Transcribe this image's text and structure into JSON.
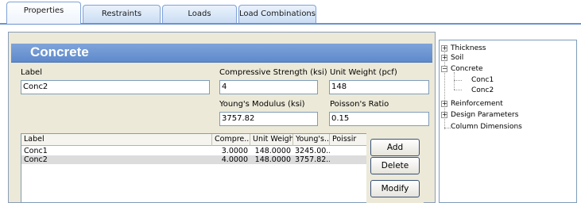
{
  "tabs": [
    {
      "label": "Properties",
      "active": true
    },
    {
      "label": "Restraints",
      "active": false
    },
    {
      "label": "Loads",
      "active": false
    },
    {
      "label": "Load Combinations",
      "active": false
    }
  ],
  "panel": {
    "title": "Concrete",
    "label_field": {
      "label": "Label",
      "value": "Conc2"
    },
    "compressive_strength": {
      "label": "Compressive Strength (ksi)",
      "value": "4"
    },
    "unit_weight": {
      "label": "Unit Weight (pcf)",
      "value": "148"
    },
    "youngs_modulus": {
      "label": "Young's Modulus (ksi)",
      "value": "3757.82"
    },
    "poissons_ratio": {
      "label": "Poisson's Ratio",
      "value": "0.15"
    }
  },
  "list": {
    "columns": [
      "Label",
      "Compre...",
      "Unit Weight",
      "Young's...",
      "Poissir"
    ],
    "rows": [
      {
        "label": "Conc1",
        "compressive": "3.0000",
        "unit_weight": "148.0000",
        "youngs": "3245.00..."
      },
      {
        "label": "Conc2",
        "compressive": "4.0000",
        "unit_weight": "148.0000",
        "youngs": "3757.82..."
      }
    ]
  },
  "buttons": {
    "add": "Add",
    "delete": "Delete",
    "modify": "Modify"
  },
  "tree": {
    "items": [
      {
        "label": "Thickness",
        "expander": "+"
      },
      {
        "label": "Soil",
        "expander": "+"
      },
      {
        "label": "Concrete",
        "expander": "−"
      },
      {
        "label": "Conc1",
        "expander": ""
      },
      {
        "label": "Conc2",
        "expander": ""
      },
      {
        "label": "Reinforcement",
        "expander": "+"
      },
      {
        "label": "Design Parameters",
        "expander": "+"
      },
      {
        "label": "Column Dimensions",
        "expander": ""
      }
    ]
  }
}
